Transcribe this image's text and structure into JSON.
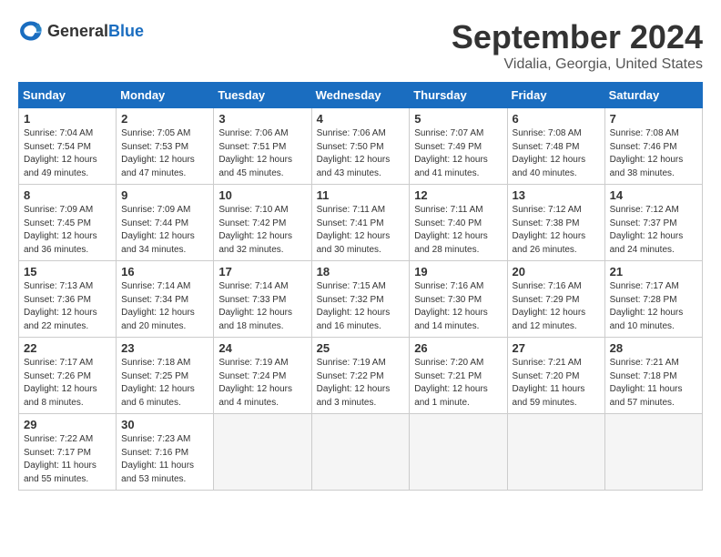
{
  "header": {
    "logo_general": "General",
    "logo_blue": "Blue",
    "month_title": "September 2024",
    "location": "Vidalia, Georgia, United States"
  },
  "days_of_week": [
    "Sunday",
    "Monday",
    "Tuesday",
    "Wednesday",
    "Thursday",
    "Friday",
    "Saturday"
  ],
  "weeks": [
    [
      {
        "day": 1,
        "sunrise": "7:04 AM",
        "sunset": "7:54 PM",
        "daylight": "12 hours and 49 minutes."
      },
      {
        "day": 2,
        "sunrise": "7:05 AM",
        "sunset": "7:53 PM",
        "daylight": "12 hours and 47 minutes."
      },
      {
        "day": 3,
        "sunrise": "7:06 AM",
        "sunset": "7:51 PM",
        "daylight": "12 hours and 45 minutes."
      },
      {
        "day": 4,
        "sunrise": "7:06 AM",
        "sunset": "7:50 PM",
        "daylight": "12 hours and 43 minutes."
      },
      {
        "day": 5,
        "sunrise": "7:07 AM",
        "sunset": "7:49 PM",
        "daylight": "12 hours and 41 minutes."
      },
      {
        "day": 6,
        "sunrise": "7:08 AM",
        "sunset": "7:48 PM",
        "daylight": "12 hours and 40 minutes."
      },
      {
        "day": 7,
        "sunrise": "7:08 AM",
        "sunset": "7:46 PM",
        "daylight": "12 hours and 38 minutes."
      }
    ],
    [
      {
        "day": 8,
        "sunrise": "7:09 AM",
        "sunset": "7:45 PM",
        "daylight": "12 hours and 36 minutes."
      },
      {
        "day": 9,
        "sunrise": "7:09 AM",
        "sunset": "7:44 PM",
        "daylight": "12 hours and 34 minutes."
      },
      {
        "day": 10,
        "sunrise": "7:10 AM",
        "sunset": "7:42 PM",
        "daylight": "12 hours and 32 minutes."
      },
      {
        "day": 11,
        "sunrise": "7:11 AM",
        "sunset": "7:41 PM",
        "daylight": "12 hours and 30 minutes."
      },
      {
        "day": 12,
        "sunrise": "7:11 AM",
        "sunset": "7:40 PM",
        "daylight": "12 hours and 28 minutes."
      },
      {
        "day": 13,
        "sunrise": "7:12 AM",
        "sunset": "7:38 PM",
        "daylight": "12 hours and 26 minutes."
      },
      {
        "day": 14,
        "sunrise": "7:12 AM",
        "sunset": "7:37 PM",
        "daylight": "12 hours and 24 minutes."
      }
    ],
    [
      {
        "day": 15,
        "sunrise": "7:13 AM",
        "sunset": "7:36 PM",
        "daylight": "12 hours and 22 minutes."
      },
      {
        "day": 16,
        "sunrise": "7:14 AM",
        "sunset": "7:34 PM",
        "daylight": "12 hours and 20 minutes."
      },
      {
        "day": 17,
        "sunrise": "7:14 AM",
        "sunset": "7:33 PM",
        "daylight": "12 hours and 18 minutes."
      },
      {
        "day": 18,
        "sunrise": "7:15 AM",
        "sunset": "7:32 PM",
        "daylight": "12 hours and 16 minutes."
      },
      {
        "day": 19,
        "sunrise": "7:16 AM",
        "sunset": "7:30 PM",
        "daylight": "12 hours and 14 minutes."
      },
      {
        "day": 20,
        "sunrise": "7:16 AM",
        "sunset": "7:29 PM",
        "daylight": "12 hours and 12 minutes."
      },
      {
        "day": 21,
        "sunrise": "7:17 AM",
        "sunset": "7:28 PM",
        "daylight": "12 hours and 10 minutes."
      }
    ],
    [
      {
        "day": 22,
        "sunrise": "7:17 AM",
        "sunset": "7:26 PM",
        "daylight": "12 hours and 8 minutes."
      },
      {
        "day": 23,
        "sunrise": "7:18 AM",
        "sunset": "7:25 PM",
        "daylight": "12 hours and 6 minutes."
      },
      {
        "day": 24,
        "sunrise": "7:19 AM",
        "sunset": "7:24 PM",
        "daylight": "12 hours and 4 minutes."
      },
      {
        "day": 25,
        "sunrise": "7:19 AM",
        "sunset": "7:22 PM",
        "daylight": "12 hours and 3 minutes."
      },
      {
        "day": 26,
        "sunrise": "7:20 AM",
        "sunset": "7:21 PM",
        "daylight": "12 hours and 1 minute."
      },
      {
        "day": 27,
        "sunrise": "7:21 AM",
        "sunset": "7:20 PM",
        "daylight": "11 hours and 59 minutes."
      },
      {
        "day": 28,
        "sunrise": "7:21 AM",
        "sunset": "7:18 PM",
        "daylight": "11 hours and 57 minutes."
      }
    ],
    [
      {
        "day": 29,
        "sunrise": "7:22 AM",
        "sunset": "7:17 PM",
        "daylight": "11 hours and 55 minutes."
      },
      {
        "day": 30,
        "sunrise": "7:23 AM",
        "sunset": "7:16 PM",
        "daylight": "11 hours and 53 minutes."
      },
      null,
      null,
      null,
      null,
      null
    ]
  ]
}
